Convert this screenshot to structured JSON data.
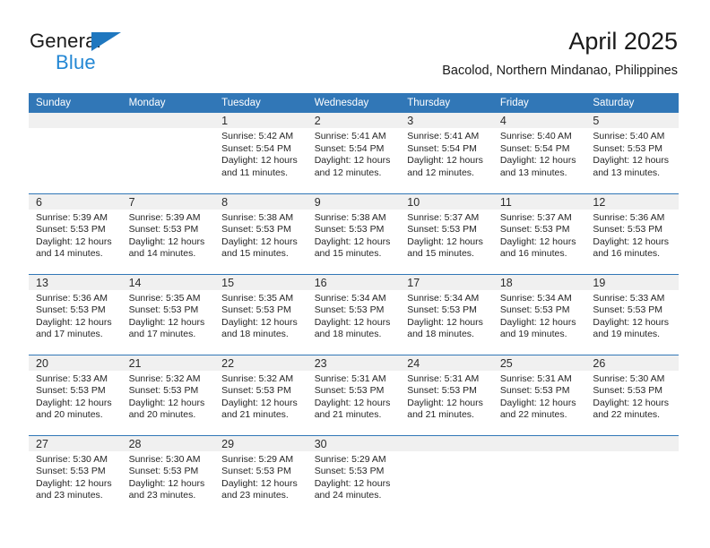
{
  "brand": {
    "name_part1": "General",
    "name_part2": "Blue",
    "triangle_color": "#1f77bf",
    "blue_color": "#2387d4"
  },
  "header": {
    "title": "April 2025",
    "subtitle": "Bacolod, Northern Mindanao, Philippines"
  },
  "theme": {
    "header_blue": "#3177b7",
    "daynum_band": "#f0f0f0",
    "text": "#262626"
  },
  "weekdays": [
    "Sunday",
    "Monday",
    "Tuesday",
    "Wednesday",
    "Thursday",
    "Friday",
    "Saturday"
  ],
  "weeks": [
    [
      {
        "day": "",
        "sunrise": "",
        "sunset": "",
        "daylight_line1": "",
        "daylight_line2": ""
      },
      {
        "day": "",
        "sunrise": "",
        "sunset": "",
        "daylight_line1": "",
        "daylight_line2": ""
      },
      {
        "day": "1",
        "sunrise": "Sunrise: 5:42 AM",
        "sunset": "Sunset: 5:54 PM",
        "daylight_line1": "Daylight: 12 hours",
        "daylight_line2": "and 11 minutes."
      },
      {
        "day": "2",
        "sunrise": "Sunrise: 5:41 AM",
        "sunset": "Sunset: 5:54 PM",
        "daylight_line1": "Daylight: 12 hours",
        "daylight_line2": "and 12 minutes."
      },
      {
        "day": "3",
        "sunrise": "Sunrise: 5:41 AM",
        "sunset": "Sunset: 5:54 PM",
        "daylight_line1": "Daylight: 12 hours",
        "daylight_line2": "and 12 minutes."
      },
      {
        "day": "4",
        "sunrise": "Sunrise: 5:40 AM",
        "sunset": "Sunset: 5:54 PM",
        "daylight_line1": "Daylight: 12 hours",
        "daylight_line2": "and 13 minutes."
      },
      {
        "day": "5",
        "sunrise": "Sunrise: 5:40 AM",
        "sunset": "Sunset: 5:53 PM",
        "daylight_line1": "Daylight: 12 hours",
        "daylight_line2": "and 13 minutes."
      }
    ],
    [
      {
        "day": "6",
        "sunrise": "Sunrise: 5:39 AM",
        "sunset": "Sunset: 5:53 PM",
        "daylight_line1": "Daylight: 12 hours",
        "daylight_line2": "and 14 minutes."
      },
      {
        "day": "7",
        "sunrise": "Sunrise: 5:39 AM",
        "sunset": "Sunset: 5:53 PM",
        "daylight_line1": "Daylight: 12 hours",
        "daylight_line2": "and 14 minutes."
      },
      {
        "day": "8",
        "sunrise": "Sunrise: 5:38 AM",
        "sunset": "Sunset: 5:53 PM",
        "daylight_line1": "Daylight: 12 hours",
        "daylight_line2": "and 15 minutes."
      },
      {
        "day": "9",
        "sunrise": "Sunrise: 5:38 AM",
        "sunset": "Sunset: 5:53 PM",
        "daylight_line1": "Daylight: 12 hours",
        "daylight_line2": "and 15 minutes."
      },
      {
        "day": "10",
        "sunrise": "Sunrise: 5:37 AM",
        "sunset": "Sunset: 5:53 PM",
        "daylight_line1": "Daylight: 12 hours",
        "daylight_line2": "and 15 minutes."
      },
      {
        "day": "11",
        "sunrise": "Sunrise: 5:37 AM",
        "sunset": "Sunset: 5:53 PM",
        "daylight_line1": "Daylight: 12 hours",
        "daylight_line2": "and 16 minutes."
      },
      {
        "day": "12",
        "sunrise": "Sunrise: 5:36 AM",
        "sunset": "Sunset: 5:53 PM",
        "daylight_line1": "Daylight: 12 hours",
        "daylight_line2": "and 16 minutes."
      }
    ],
    [
      {
        "day": "13",
        "sunrise": "Sunrise: 5:36 AM",
        "sunset": "Sunset: 5:53 PM",
        "daylight_line1": "Daylight: 12 hours",
        "daylight_line2": "and 17 minutes."
      },
      {
        "day": "14",
        "sunrise": "Sunrise: 5:35 AM",
        "sunset": "Sunset: 5:53 PM",
        "daylight_line1": "Daylight: 12 hours",
        "daylight_line2": "and 17 minutes."
      },
      {
        "day": "15",
        "sunrise": "Sunrise: 5:35 AM",
        "sunset": "Sunset: 5:53 PM",
        "daylight_line1": "Daylight: 12 hours",
        "daylight_line2": "and 18 minutes."
      },
      {
        "day": "16",
        "sunrise": "Sunrise: 5:34 AM",
        "sunset": "Sunset: 5:53 PM",
        "daylight_line1": "Daylight: 12 hours",
        "daylight_line2": "and 18 minutes."
      },
      {
        "day": "17",
        "sunrise": "Sunrise: 5:34 AM",
        "sunset": "Sunset: 5:53 PM",
        "daylight_line1": "Daylight: 12 hours",
        "daylight_line2": "and 18 minutes."
      },
      {
        "day": "18",
        "sunrise": "Sunrise: 5:34 AM",
        "sunset": "Sunset: 5:53 PM",
        "daylight_line1": "Daylight: 12 hours",
        "daylight_line2": "and 19 minutes."
      },
      {
        "day": "19",
        "sunrise": "Sunrise: 5:33 AM",
        "sunset": "Sunset: 5:53 PM",
        "daylight_line1": "Daylight: 12 hours",
        "daylight_line2": "and 19 minutes."
      }
    ],
    [
      {
        "day": "20",
        "sunrise": "Sunrise: 5:33 AM",
        "sunset": "Sunset: 5:53 PM",
        "daylight_line1": "Daylight: 12 hours",
        "daylight_line2": "and 20 minutes."
      },
      {
        "day": "21",
        "sunrise": "Sunrise: 5:32 AM",
        "sunset": "Sunset: 5:53 PM",
        "daylight_line1": "Daylight: 12 hours",
        "daylight_line2": "and 20 minutes."
      },
      {
        "day": "22",
        "sunrise": "Sunrise: 5:32 AM",
        "sunset": "Sunset: 5:53 PM",
        "daylight_line1": "Daylight: 12 hours",
        "daylight_line2": "and 21 minutes."
      },
      {
        "day": "23",
        "sunrise": "Sunrise: 5:31 AM",
        "sunset": "Sunset: 5:53 PM",
        "daylight_line1": "Daylight: 12 hours",
        "daylight_line2": "and 21 minutes."
      },
      {
        "day": "24",
        "sunrise": "Sunrise: 5:31 AM",
        "sunset": "Sunset: 5:53 PM",
        "daylight_line1": "Daylight: 12 hours",
        "daylight_line2": "and 21 minutes."
      },
      {
        "day": "25",
        "sunrise": "Sunrise: 5:31 AM",
        "sunset": "Sunset: 5:53 PM",
        "daylight_line1": "Daylight: 12 hours",
        "daylight_line2": "and 22 minutes."
      },
      {
        "day": "26",
        "sunrise": "Sunrise: 5:30 AM",
        "sunset": "Sunset: 5:53 PM",
        "daylight_line1": "Daylight: 12 hours",
        "daylight_line2": "and 22 minutes."
      }
    ],
    [
      {
        "day": "27",
        "sunrise": "Sunrise: 5:30 AM",
        "sunset": "Sunset: 5:53 PM",
        "daylight_line1": "Daylight: 12 hours",
        "daylight_line2": "and 23 minutes."
      },
      {
        "day": "28",
        "sunrise": "Sunrise: 5:30 AM",
        "sunset": "Sunset: 5:53 PM",
        "daylight_line1": "Daylight: 12 hours",
        "daylight_line2": "and 23 minutes."
      },
      {
        "day": "29",
        "sunrise": "Sunrise: 5:29 AM",
        "sunset": "Sunset: 5:53 PM",
        "daylight_line1": "Daylight: 12 hours",
        "daylight_line2": "and 23 minutes."
      },
      {
        "day": "30",
        "sunrise": "Sunrise: 5:29 AM",
        "sunset": "Sunset: 5:53 PM",
        "daylight_line1": "Daylight: 12 hours",
        "daylight_line2": "and 24 minutes."
      },
      {
        "day": "",
        "sunrise": "",
        "sunset": "",
        "daylight_line1": "",
        "daylight_line2": ""
      },
      {
        "day": "",
        "sunrise": "",
        "sunset": "",
        "daylight_line1": "",
        "daylight_line2": ""
      },
      {
        "day": "",
        "sunrise": "",
        "sunset": "",
        "daylight_line1": "",
        "daylight_line2": ""
      }
    ]
  ]
}
